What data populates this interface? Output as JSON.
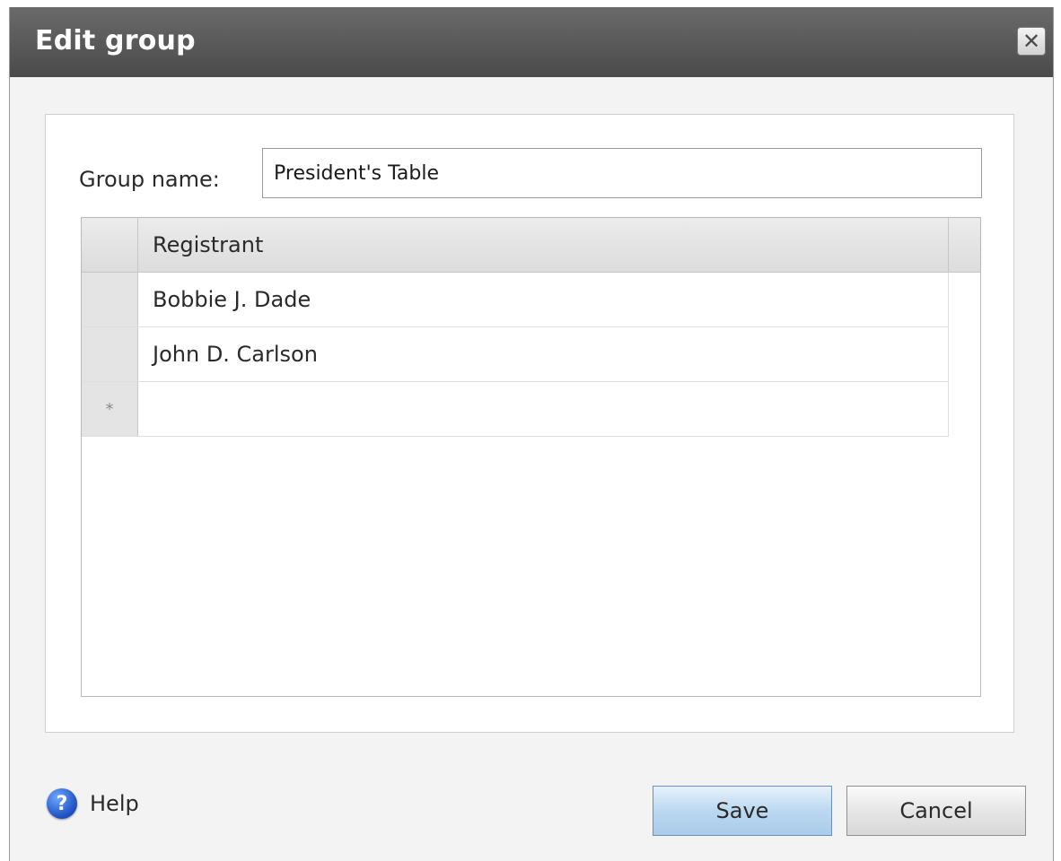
{
  "dialog": {
    "title": "Edit group",
    "close_icon": "close-icon"
  },
  "form": {
    "group_name_label": "Group name:",
    "group_name_value": "President's Table"
  },
  "grid": {
    "columns": [
      "Registrant"
    ],
    "rows": [
      {
        "selector": "",
        "registrant": "Bobbie J. Dade"
      },
      {
        "selector": "",
        "registrant": "John D. Carlson"
      },
      {
        "selector": "*",
        "registrant": ""
      }
    ]
  },
  "footer": {
    "help_icon": "help-icon",
    "help_label": "Help",
    "save_label": "Save",
    "cancel_label": "Cancel"
  }
}
